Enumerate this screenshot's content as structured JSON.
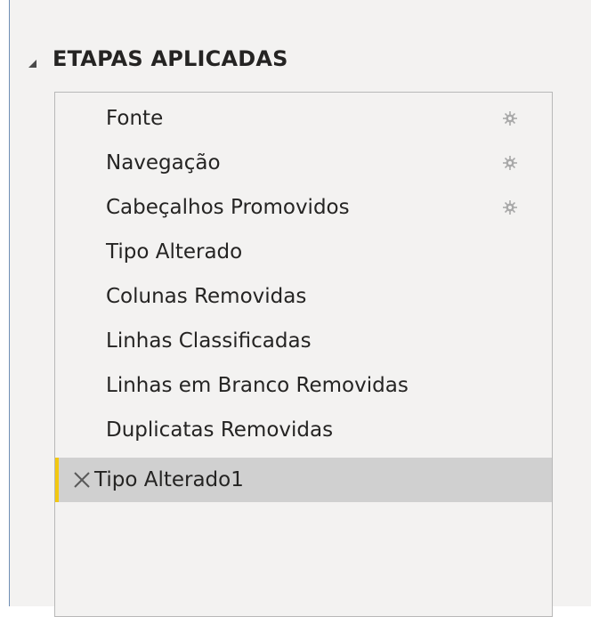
{
  "section": {
    "title": "ETAPAS APLICADAS",
    "arrow_icon": "collapse-triangle-icon"
  },
  "steps": [
    {
      "label": "Fonte",
      "has_settings": true
    },
    {
      "label": "Navegação",
      "has_settings": true
    },
    {
      "label": "Cabeçalhos Promovidos",
      "has_settings": true
    },
    {
      "label": "Tipo Alterado",
      "has_settings": false
    },
    {
      "label": "Colunas Removidas",
      "has_settings": false
    },
    {
      "label": "Linhas Classificadas",
      "has_settings": false
    },
    {
      "label": "Linhas em Branco Removidas",
      "has_settings": false
    },
    {
      "label": "Duplicatas Removidas",
      "has_settings": false
    },
    {
      "label": "Tipo Alterado1",
      "has_settings": false,
      "selected": true
    }
  ],
  "colors": {
    "selected_marker": "#f2c811",
    "selected_background": "#d0d0d0",
    "pane_background": "#f3f2f1"
  }
}
